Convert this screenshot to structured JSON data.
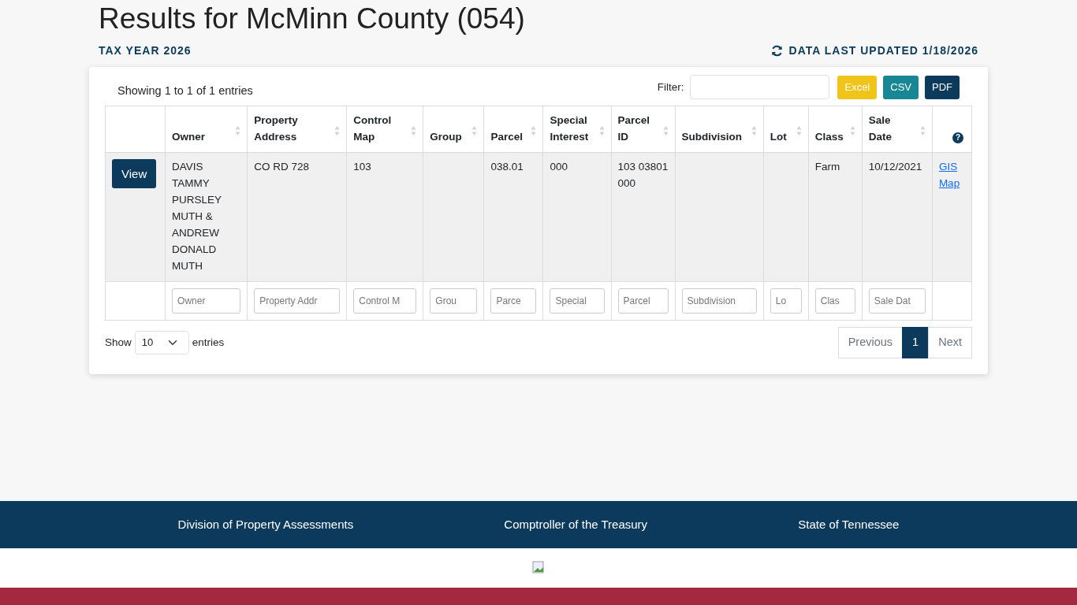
{
  "page": {
    "title": "Results for McMinn County (054)",
    "tax_year": "TAX YEAR 2026",
    "updated": "DATA LAST UPDATED 1/18/2026"
  },
  "table_info": "Showing 1 to 1 of 1 entries",
  "filter": {
    "label": "Filter:"
  },
  "export_buttons": [
    {
      "label": "Excel",
      "kind": "excel"
    },
    {
      "label": "CSV",
      "kind": "csv"
    },
    {
      "label": "PDF",
      "kind": "pdf"
    }
  ],
  "table": {
    "columns": [
      {
        "label": "Owner",
        "sortable": true
      },
      {
        "label": "Property Address",
        "sortable": true
      },
      {
        "label": "Control Map",
        "sortable": true
      },
      {
        "label": "Group",
        "sortable": true
      },
      {
        "label": "Parcel",
        "sortable": true
      },
      {
        "label": "Special Interest",
        "sortable": true
      },
      {
        "label": "Parcel ID",
        "sortable": true
      },
      {
        "label": "Subdivision",
        "sortable": true
      },
      {
        "label": "Lot",
        "sortable": true
      },
      {
        "label": "Class",
        "sortable": true
      },
      {
        "label": "Sale Date",
        "sortable": true
      },
      {
        "label": "?",
        "sortable": false,
        "kind": "help"
      }
    ],
    "rows": [
      {
        "view": "View",
        "cells": [
          "DAVIS TAMMY PURSLEY MUTH & ANDREW DONALD MUTH",
          "CO RD 728",
          "103",
          "",
          "038.01",
          "000",
          "103 03801 000",
          "",
          "",
          "Farm",
          "10/12/2021"
        ],
        "link": "GIS Map"
      }
    ],
    "column_filters": [
      {
        "placeholder": "Owner"
      },
      {
        "placeholder": "Property Addr"
      },
      {
        "placeholder": "Control M"
      },
      {
        "placeholder": "Grou"
      },
      {
        "placeholder": "Parce"
      },
      {
        "placeholder": "Special"
      },
      {
        "placeholder": "Parcel"
      },
      {
        "placeholder": "Subdivision"
      },
      {
        "placeholder": "Lo"
      },
      {
        "placeholder": "Clas"
      },
      {
        "placeholder": "Sale Dat"
      }
    ]
  },
  "length": {
    "show": "Show",
    "value": "10",
    "entries": "entries"
  },
  "pagination": [
    {
      "label": "Previous",
      "selected": false
    },
    {
      "label": "1",
      "selected": true
    },
    {
      "label": "Next",
      "selected": false
    }
  ],
  "footer": {
    "links": [
      "Division of Property Assessments",
      "Comptroller of the Treasury",
      "State of Tennessee"
    ]
  }
}
